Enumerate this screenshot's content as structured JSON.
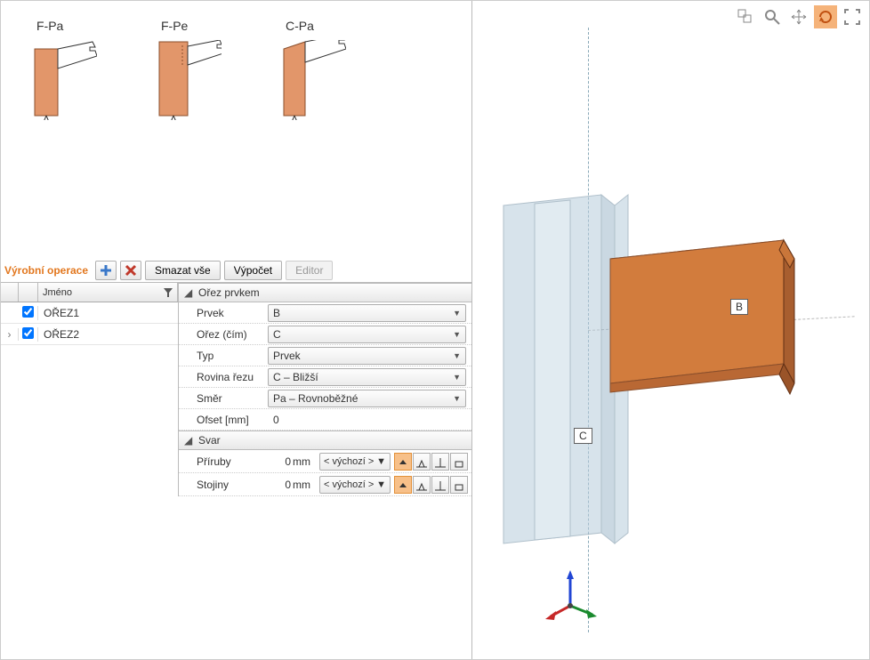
{
  "types": {
    "fpa": "F-Pa",
    "fpe": "F-Pe",
    "cpa": "C-Pa"
  },
  "opsbar": {
    "title": "Výrobní operace",
    "clear": "Smazat vše",
    "calc": "Výpočet",
    "editor": "Editor"
  },
  "grid": {
    "name_header": "Jméno",
    "rows": [
      {
        "name": "OŘEZ1",
        "checked": true,
        "selected": false
      },
      {
        "name": "OŘEZ2",
        "checked": true,
        "selected": true
      }
    ]
  },
  "props": {
    "section_cut": "Ořez prvkem",
    "prvek": {
      "label": "Prvek",
      "value": "B"
    },
    "orez": {
      "label": "Ořez (čím)",
      "value": "C"
    },
    "typ": {
      "label": "Typ",
      "value": "Prvek"
    },
    "rovina": {
      "label": "Rovina řezu",
      "value": "C – Bližší"
    },
    "smer": {
      "label": "Směr",
      "value": "Pa – Rovnoběžné"
    },
    "ofset": {
      "label": "Ofset [mm]",
      "value": "0"
    },
    "section_weld": "Svar",
    "priruby": {
      "label": "Příruby",
      "value": "0",
      "unit": "mm",
      "preset": "< výchozí >"
    },
    "stojiny": {
      "label": "Stojiny",
      "value": "0",
      "unit": "mm",
      "preset": "< výchozí >"
    }
  },
  "scene": {
    "labelB": "B",
    "labelC": "C"
  }
}
